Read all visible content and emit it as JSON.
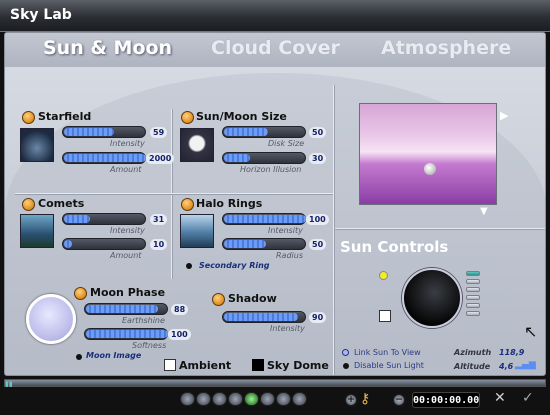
{
  "window": {
    "title": "Sky Lab"
  },
  "tabs": [
    {
      "label": "Sun & Moon",
      "active": true
    },
    {
      "label": "Cloud Cover",
      "active": false
    },
    {
      "label": "Atmosphere",
      "active": false
    }
  ],
  "starfield": {
    "label": "Starfield",
    "sliders": [
      {
        "caption": "Intensity",
        "value": "59",
        "level": 0.59
      },
      {
        "caption": "Amount",
        "value": "2000",
        "level": 1.0
      }
    ]
  },
  "sunmoon_size": {
    "label": "Sun/Moon Size",
    "sliders": [
      {
        "caption": "Disk Size",
        "value": "50",
        "level": 0.5
      },
      {
        "caption": "Horizon Illusion",
        "value": "30",
        "level": 0.3
      }
    ]
  },
  "comets": {
    "label": "Comets",
    "sliders": [
      {
        "caption": "Intensity",
        "value": "31",
        "level": 0.31
      },
      {
        "caption": "Amount",
        "value": "10",
        "level": 0.1
      }
    ]
  },
  "halo_rings": {
    "label": "Halo Rings",
    "sliders": [
      {
        "caption": "Intensity",
        "value": "100",
        "level": 1.0
      },
      {
        "caption": "Radius",
        "value": "50",
        "level": 0.5
      }
    ],
    "secondary": "Secondary Ring"
  },
  "moon_phase": {
    "label": "Moon Phase",
    "sliders": [
      {
        "caption": "Earthshine",
        "value": "88",
        "level": 0.88
      },
      {
        "caption": "Softness",
        "value": "100",
        "level": 1.0
      }
    ],
    "moon_image": "Moon Image"
  },
  "shadow": {
    "label": "Shadow",
    "sliders": [
      {
        "caption": "Intensity",
        "value": "90",
        "level": 0.9
      }
    ]
  },
  "toggles": {
    "ambient": "Ambient",
    "sky_dome": "Sky Dome"
  },
  "sun_controls": {
    "title": "Sun Controls",
    "link_sun": "Link Sun To View",
    "disable_sun": "Disable Sun Light",
    "azimuth_label": "Azimuth",
    "azimuth": "118,9",
    "altitude_label": "Altitude",
    "altitude": "4,6"
  },
  "timeline": {
    "time": "00:00:00.00"
  },
  "colors": {
    "accent_blue": "#5b8ef0",
    "orange_dot": "#e08a1e",
    "sky_pink": "#e9c6e7",
    "sky_purple": "#8a3ea6"
  },
  "icons": [
    "sun-orange-dot",
    "key-icon",
    "close-x-icon",
    "check-icon"
  ]
}
